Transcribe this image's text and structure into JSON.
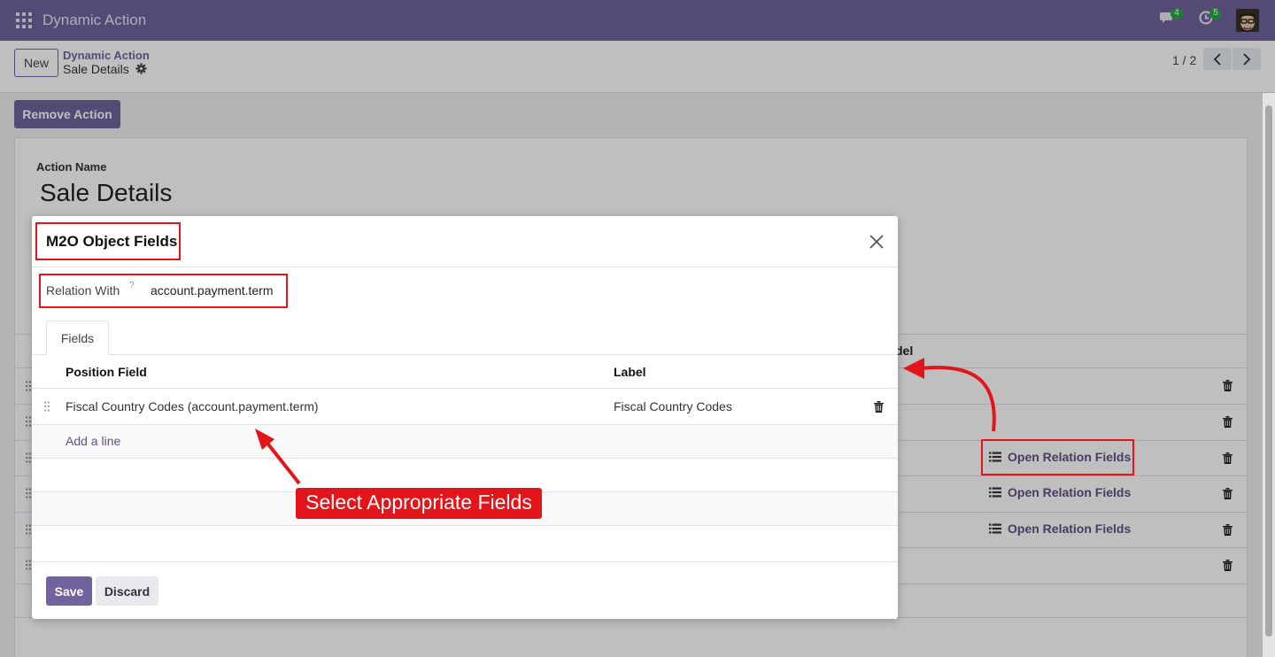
{
  "navbar": {
    "app_title": "Dynamic Action",
    "messages_count": "4",
    "activities_count": "5"
  },
  "control_panel": {
    "new_label": "New",
    "breadcrumb_parent": "Dynamic Action",
    "breadcrumb_current": "Sale Details",
    "pager": "1 / 2"
  },
  "form": {
    "remove_action_label": "Remove Action",
    "action_name_label": "Action Name",
    "action_name": "Sale Details",
    "column_header_partial": "del",
    "open_relation_fields_label": "Open Relation Fields"
  },
  "dialog": {
    "title": "M2O Object Fields",
    "relation_label": "Relation With",
    "relation_help": "?",
    "relation_value": "account.payment.term",
    "tab_fields": "Fields",
    "columns": {
      "position_field": "Position Field",
      "label": "Label"
    },
    "rows": [
      {
        "position_field": "Fiscal Country Codes (account.payment.term)",
        "label": "Fiscal Country Codes"
      }
    ],
    "add_line": "Add a line",
    "save_label": "Save",
    "discard_label": "Discard"
  },
  "annotation": {
    "callout": "Select Appropriate Fields",
    "color": "#e3151a"
  },
  "colors": {
    "brand": "#71639e",
    "link": "#5f5280"
  }
}
